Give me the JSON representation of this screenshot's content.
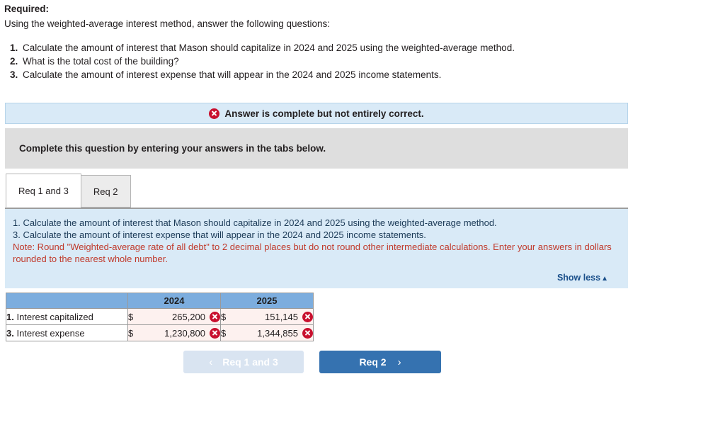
{
  "required": {
    "title": "Required:",
    "subtitle": "Using the weighted-average interest method, answer the following questions:",
    "items": [
      {
        "num": "1.",
        "text": "Calculate the amount of interest that Mason should capitalize in 2024 and 2025 using the weighted-average method."
      },
      {
        "num": "2.",
        "text": "What is the total cost of the building?"
      },
      {
        "num": "3.",
        "text": "Calculate the amount of interest expense that will appear in the 2024 and 2025 income statements."
      }
    ]
  },
  "alert": {
    "icon": "error-x-icon",
    "message": "Answer is complete but not entirely correct.",
    "background_color": "#d9eaf7",
    "icon_color": "#c8102e"
  },
  "instruction_banner": {
    "text": "Complete this question by entering your answers in the tabs below.",
    "background_color": "#dedede"
  },
  "tabs": [
    {
      "label": "Req 1 and 3",
      "active": true
    },
    {
      "label": "Req 2",
      "active": false
    }
  ],
  "question_panel": {
    "line1": "1. Calculate the amount of interest that Mason should capitalize in 2024 and 2025 using the weighted-average method.",
    "line2": "3. Calculate the amount of interest expense that will appear in the 2024 and 2025 income statements.",
    "note": "Note: Round \"Weighted-average rate of all debt\" to 2 decimal places but do not round other intermediate calculations. Enter your answers in dollars rounded to the nearest whole number.",
    "show_less_label": "Show less",
    "show_less_caret": "▲",
    "background_color": "#d9eaf7",
    "note_color": "#c0392b",
    "link_color": "#1a4f8a"
  },
  "answer_table": {
    "header_color": "#7cadde",
    "incorrect_cell_color": "#fdf1ef",
    "columns": [
      "",
      "2024",
      "2025"
    ],
    "rows": [
      {
        "num": "1.",
        "label": "Interest capitalized",
        "cells": [
          {
            "currency": "$",
            "value": "265,200",
            "status": "incorrect"
          },
          {
            "currency": "$",
            "value": "151,145",
            "status": "incorrect"
          }
        ]
      },
      {
        "num": "3.",
        "label": "Interest expense",
        "cells": [
          {
            "currency": "$",
            "value": "1,230,800",
            "status": "incorrect"
          },
          {
            "currency": "$",
            "value": "1,344,855",
            "status": "incorrect"
          }
        ]
      }
    ]
  },
  "navigation": {
    "prev_label": "Req 1 and 3",
    "prev_chevron": "‹",
    "prev_disabled": true,
    "next_label": "Req 2",
    "next_chevron": "›",
    "next_color": "#3572b0",
    "prev_color": "#d9e4f1"
  }
}
